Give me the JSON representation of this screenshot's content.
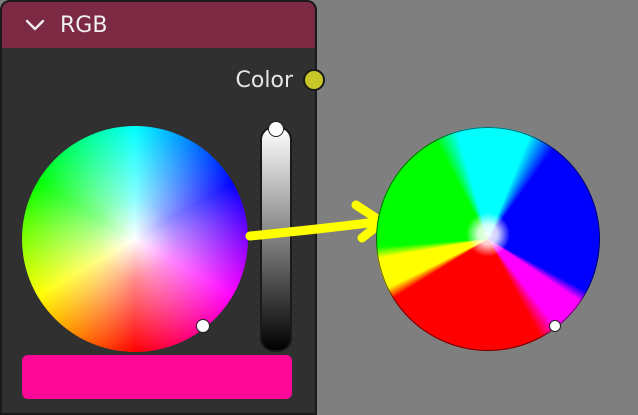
{
  "node": {
    "title": "RGB",
    "output_socket_label": "Color",
    "header_color": "#7c2a44",
    "socket_color": "#c7c729",
    "swatch_color": "#ff0898",
    "value_level": 1.0
  },
  "annotation": {
    "arrow_color": "#ffff00"
  },
  "icons": [
    "chevron-down-icon"
  ]
}
